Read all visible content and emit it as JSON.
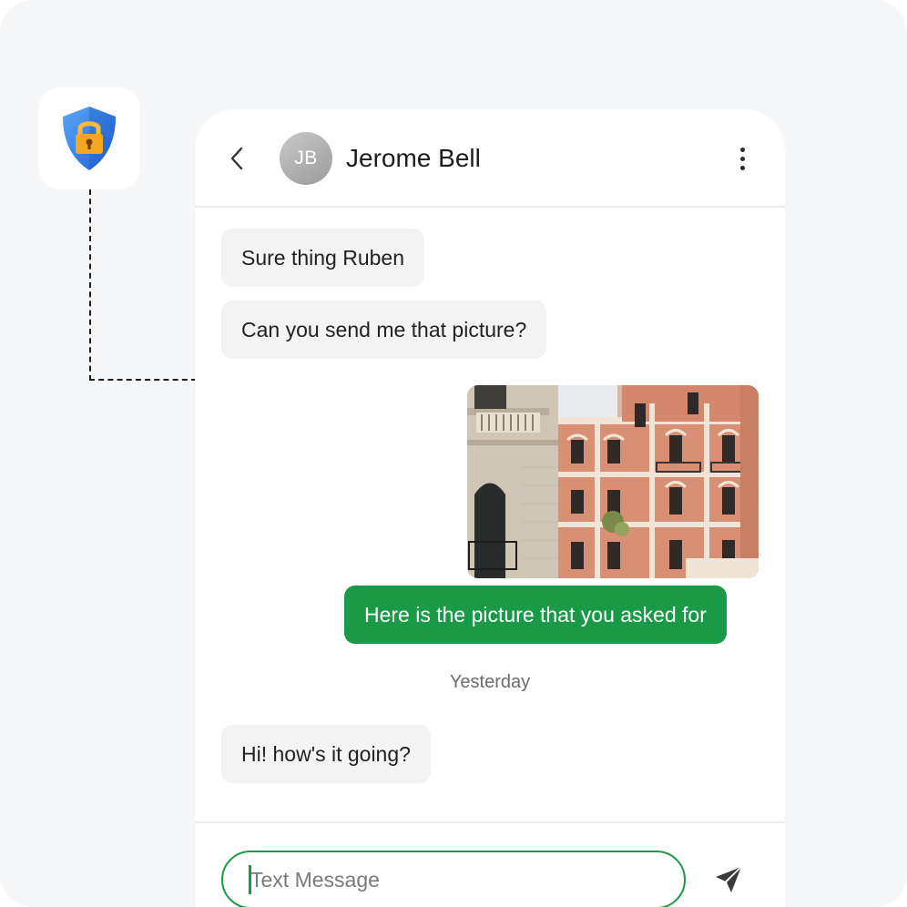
{
  "contact": {
    "initials": "JB",
    "name": "Jerome Bell"
  },
  "messages": [
    {
      "direction": "incoming",
      "text": "Sure thing Ruben"
    },
    {
      "direction": "incoming",
      "text": "Can you send me that picture?"
    },
    {
      "direction": "outgoing",
      "text": "Here is the picture that you asked for"
    },
    {
      "direction": "incoming",
      "text": "Hi! how's it going?"
    }
  ],
  "day_separator": "Yesterday",
  "composer": {
    "placeholder": "Text Message"
  },
  "icons": {
    "security": "shield-lock-icon",
    "back": "chevron-left-icon",
    "more": "more-vertical-icon",
    "send": "send-icon"
  },
  "colors": {
    "accent_green": "#1a9a47",
    "incoming_bubble": "#f3f3f4",
    "shield_blue": "#2f7de0",
    "lock_orange": "#f4a623"
  }
}
